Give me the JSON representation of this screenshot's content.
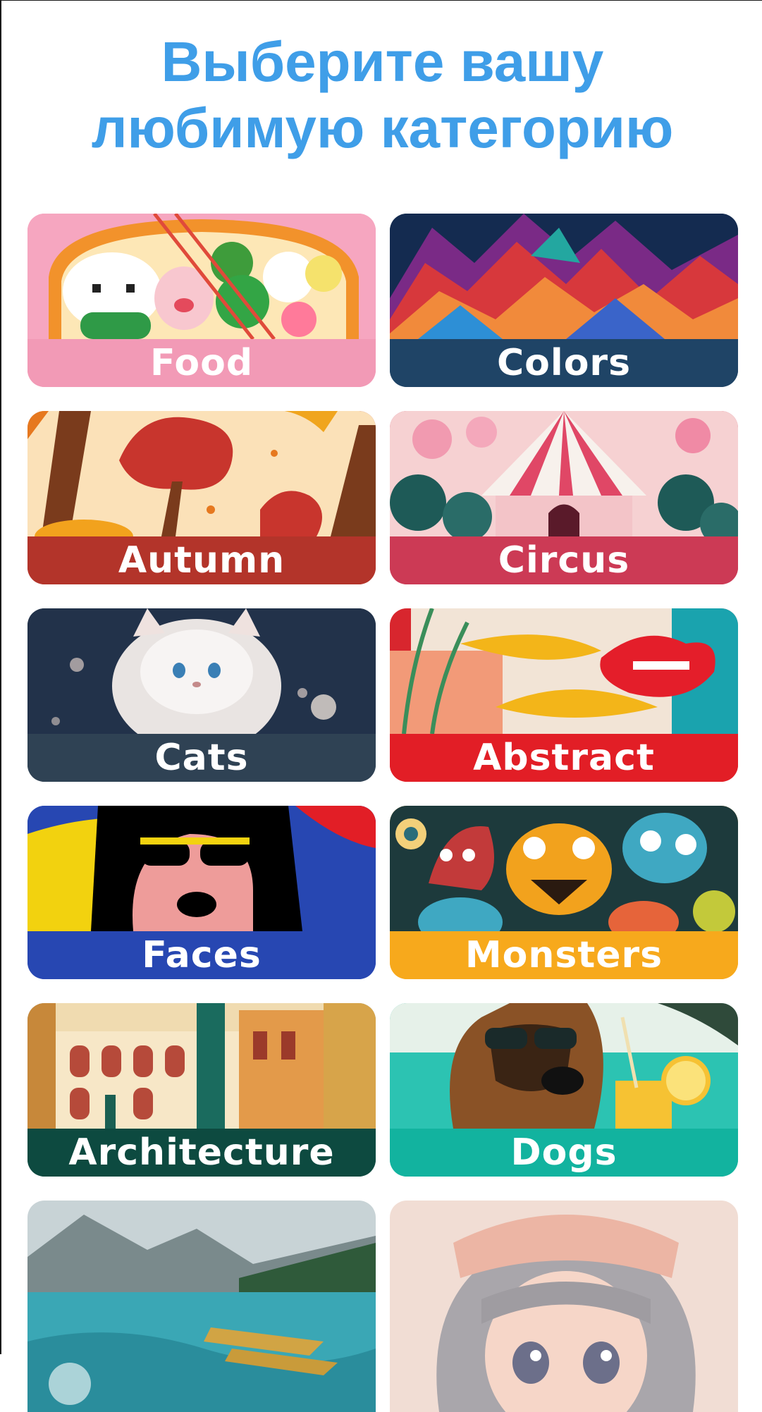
{
  "header": {
    "title_line1": "Выберите вашу",
    "title_line2": "любимую категорию"
  },
  "categories": [
    {
      "label": "Food",
      "bar_color": "#f29ab6"
    },
    {
      "label": "Colors",
      "bar_color": "#1f4466"
    },
    {
      "label": "Autumn",
      "bar_color": "#b3342a"
    },
    {
      "label": "Circus",
      "bar_color": "#cc3a55"
    },
    {
      "label": "Cats",
      "bar_color": "#2f4254"
    },
    {
      "label": "Abstract",
      "bar_color": "#e21e26"
    },
    {
      "label": "Faces",
      "bar_color": "#2747b2"
    },
    {
      "label": "Monsters",
      "bar_color": "#f7a91c"
    },
    {
      "label": "Architecture",
      "bar_color": "#0d4a40"
    },
    {
      "label": "Dogs",
      "bar_color": "#12b39f"
    },
    {
      "label": "",
      "bar_color": "#3aa7b5"
    },
    {
      "label": "",
      "bar_color": "#f1d8cf"
    }
  ],
  "colors": {
    "title": "#3f9ee8",
    "background": "#ffffff"
  }
}
